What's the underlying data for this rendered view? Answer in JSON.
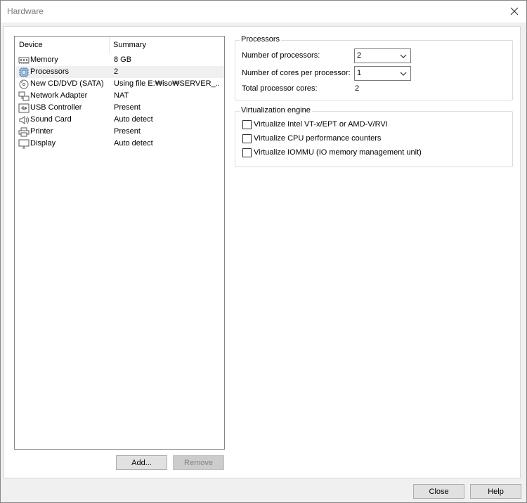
{
  "window": {
    "title": "Hardware"
  },
  "device_list": {
    "columns": {
      "device": "Device",
      "summary": "Summary"
    },
    "rows": [
      {
        "name": "Memory",
        "summary": "8 GB",
        "icon": "memory-icon"
      },
      {
        "name": "Processors",
        "summary": "2",
        "icon": "processor-icon",
        "selected": true
      },
      {
        "name": "New CD/DVD (SATA)",
        "summary": "Using file E:₩iso₩SERVER_...",
        "icon": "cd-dvd-icon"
      },
      {
        "name": "Network Adapter",
        "summary": "NAT",
        "icon": "network-adapter-icon"
      },
      {
        "name": "USB Controller",
        "summary": "Present",
        "icon": "usb-icon"
      },
      {
        "name": "Sound Card",
        "summary": "Auto detect",
        "icon": "speaker-icon"
      },
      {
        "name": "Printer",
        "summary": "Present",
        "icon": "printer-icon"
      },
      {
        "name": "Display",
        "summary": "Auto detect",
        "icon": "monitor-icon"
      }
    ]
  },
  "list_buttons": {
    "add": "Add...",
    "remove": "Remove"
  },
  "processors": {
    "group_title": "Processors",
    "num_processors_label": "Number of processors:",
    "num_processors_value": "2",
    "cores_per_processor_label": "Number of cores per processor:",
    "cores_per_processor_value": "1",
    "total_cores_label": "Total processor cores:",
    "total_cores_value": "2"
  },
  "virtualization": {
    "group_title": "Virtualization engine",
    "options": [
      {
        "label": "Virtualize Intel VT-x/EPT or AMD-V/RVI",
        "checked": false
      },
      {
        "label": "Virtualize CPU performance counters",
        "checked": false
      },
      {
        "label": "Virtualize IOMMU (IO memory management unit)",
        "checked": false
      }
    ]
  },
  "footer_buttons": {
    "close": "Close",
    "help": "Help"
  }
}
